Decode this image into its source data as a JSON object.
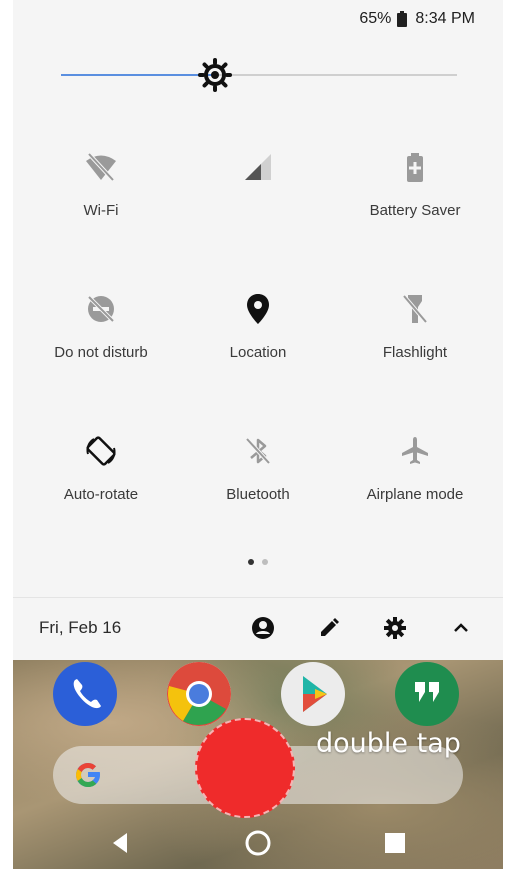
{
  "status_bar": {
    "battery": "65%",
    "time": "8:34 PM"
  },
  "brightness": {
    "level": 0.39
  },
  "tiles": [
    {
      "label": "Wi-Fi",
      "icon": "wifi-off-icon"
    },
    {
      "label": "",
      "icon": "cell-signal-icon"
    },
    {
      "label": "Battery Saver",
      "icon": "battery-saver-icon"
    },
    {
      "label": "Do not disturb",
      "icon": "do-not-disturb-icon"
    },
    {
      "label": "Location",
      "icon": "location-pin-icon"
    },
    {
      "label": "Flashlight",
      "icon": "flashlight-icon"
    },
    {
      "label": "Auto-rotate",
      "icon": "auto-rotate-icon"
    },
    {
      "label": "Bluetooth",
      "icon": "bluetooth-off-icon"
    },
    {
      "label": "Airplane mode",
      "icon": "airplane-icon"
    }
  ],
  "page_indicator": {
    "current": 1,
    "total": 2
  },
  "footer": {
    "date": "Fri, Feb 16"
  },
  "home": {
    "hint": "double tap"
  },
  "colors": {
    "accent": "#5a8fe0",
    "record": "#ef2b2b",
    "panel": "#f5f5f5"
  }
}
